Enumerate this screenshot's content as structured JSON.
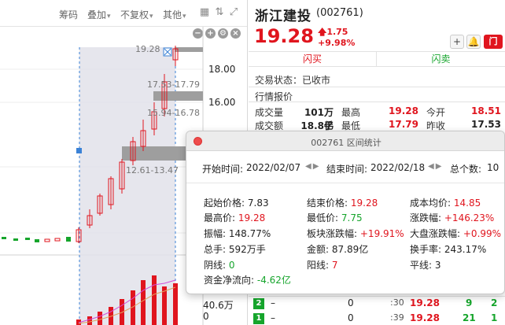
{
  "toolbar": {
    "items": [
      "筹码",
      "叠加",
      "不复权",
      "其他"
    ]
  },
  "chart": {
    "price_labels": [
      "18.00",
      "16.00"
    ],
    "range_annotations": [
      "19.28",
      "17.53-17.79",
      "15.94-16.78",
      "12.61-13.47"
    ],
    "volume_labels": [
      "40.6万",
      "0"
    ]
  },
  "quote": {
    "stock_name": "浙江建投",
    "stock_code": "(002761)",
    "last_price": "19.28",
    "change_abs": "1.75",
    "change_pct": "+9.98%",
    "trade_label": "门",
    "flash_buy": "闪买",
    "flash_sell": "闪卖",
    "trade_status": "交易状态：已收市",
    "section_title": "行情报价",
    "rows": [
      {
        "l1": "成交量",
        "v1": "101万手",
        "l2": "最高",
        "v2": "19.28",
        "l3": "今开",
        "v3": "18.51"
      },
      {
        "l1": "成交额",
        "v1": "18.8亿",
        "l2": "最低",
        "v2": "17.79",
        "l3": "昨收",
        "v3": "17.53"
      }
    ],
    "ticks": [
      {
        "badge": "2",
        "sep": "–",
        "qty": "0",
        "time": ":30",
        "price": "19.28",
        "vol": "9",
        "extra": "2"
      },
      {
        "badge": "1",
        "sep": "–",
        "qty": "0",
        "time": ":39",
        "price": "19.28",
        "vol": "21",
        "extra": "1"
      }
    ]
  },
  "popup": {
    "title": "002761 区间统计",
    "start_label": "开始时间:",
    "start_value": "2022/02/07",
    "end_label": "结束时间:",
    "end_value": "2022/02/18",
    "total_label": "总个数:",
    "total_value": "10",
    "stats": {
      "start_price_label": "起始价格:",
      "start_price": "7.83",
      "end_price_label": "结束价格:",
      "end_price": "19.28",
      "avg_cost_label": "成本均价:",
      "avg_cost": "14.85",
      "high_label": "最高价:",
      "high": "19.28",
      "low_label": "最低价:",
      "low": "7.75",
      "change_label": "涨跌幅:",
      "change": "+146.23%",
      "amplitude_label": "振幅:",
      "amplitude": "148.77%",
      "sector_change_label": "板块涨跌幅:",
      "sector_change": "+19.91%",
      "market_change_label": "大盘涨跌幅:",
      "market_change": "+0.99%",
      "volume_label": "总手:",
      "volume": "592万手",
      "amount_label": "金额:",
      "amount": "87.89亿",
      "turnover_label": "换手率:",
      "turnover": "243.17%",
      "down_count_label": "阴线:",
      "down_count": "0",
      "up_count_label": "阳线:",
      "up_count": "7",
      "flat_count_label": "平线:",
      "flat_count": "3",
      "net_flow_label": "资金净流向:",
      "net_flow": "-4.62亿"
    }
  },
  "colors": {
    "up": "#e0151e",
    "down": "#16a52c",
    "selection": "#dcdce6",
    "handle": "#3b82d6"
  }
}
